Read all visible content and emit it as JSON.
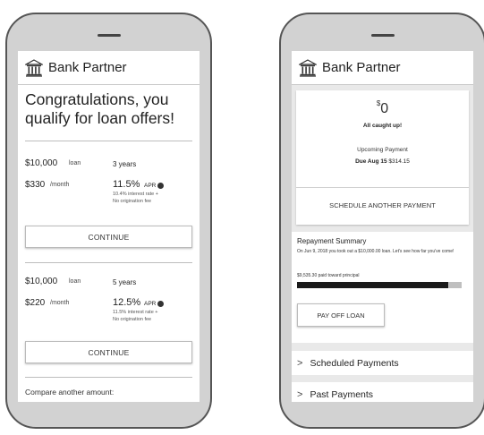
{
  "app": {
    "name": "Bank Partner"
  },
  "offers_screen": {
    "headline": "Congratulations, you qualify for loan offers!",
    "offers": [
      {
        "loan_amount": "$10,000",
        "loan_unit": "loan",
        "term": "3 years",
        "monthly_amount": "$330",
        "monthly_unit": "/month",
        "apr_value": "11.5%",
        "apr_label": "APR",
        "rate_note_1": "10.4% interest rate +",
        "rate_note_2": "No origination fee",
        "button": "CONTINUE"
      },
      {
        "loan_amount": "$10,000",
        "loan_unit": "loan",
        "term": "5 years",
        "monthly_amount": "$220",
        "monthly_unit": "/month",
        "apr_value": "12.5%",
        "apr_label": "APR",
        "rate_note_1": "11.5% interest rate +",
        "rate_note_2": "No origination fee",
        "button": "CONTINUE"
      }
    ],
    "compare_link": "Compare another amount:"
  },
  "account_screen": {
    "balance_currency": "$",
    "balance_value": "0",
    "caught_up": "All caught up!",
    "upcoming_label": "Upcoming Payment",
    "due_label": "Due Aug 15",
    "due_amount": "$314.15",
    "schedule_button": "SCHEDULE ANOTHER PAYMENT",
    "summary": {
      "title": "Repayment Summary",
      "description": "On Jun 9, 2018 you took out a $10,000.00 loan.  Let's see how far you've come!",
      "paid_text": "$9,535.30 paid toward principal",
      "progress_fraction": 0.92,
      "payoff_button": "PAY OFF LOAN"
    },
    "rows": {
      "scheduled": "Scheduled Payments",
      "past": "Past Payments"
    }
  },
  "colors": {
    "device_bezel": "#d2d2d2",
    "progress_fill": "#1a1a1a",
    "progress_track": "#bfbfbf"
  },
  "icons": [
    "bank-icon",
    "info-icon",
    "chevron-right-icon"
  ]
}
